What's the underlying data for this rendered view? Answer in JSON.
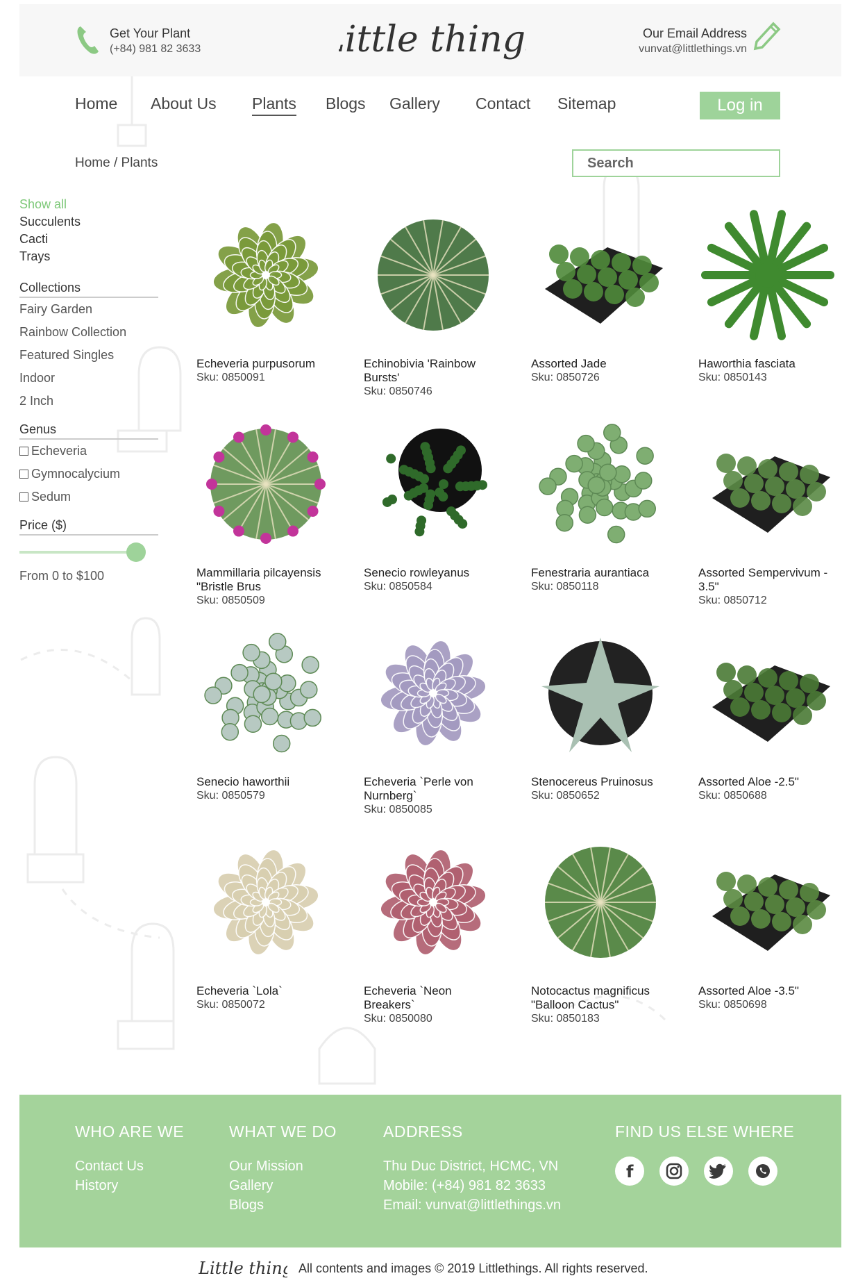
{
  "header": {
    "phone_title": "Get Your Plant",
    "phone_number": "(+84) 981 82 3633",
    "logo_text": "Little things",
    "email_title": "Our Email Address",
    "email_value": "vunvat@littlethings.vn"
  },
  "nav": {
    "items": [
      "Home",
      "About Us",
      "Plants",
      "Blogs",
      "Gallery",
      "Contact",
      "Sitemap"
    ],
    "active": "Plants",
    "login_label": "Log in"
  },
  "breadcrumb": "Home / Plants",
  "search": {
    "placeholder": "Search"
  },
  "sidebar": {
    "categories": [
      "Show all",
      "Succulents",
      "Cacti",
      "Trays"
    ],
    "collections_heading": "Collections",
    "collections": [
      "Fairy Garden",
      "Rainbow Collection",
      "Featured Singles",
      "Indoor",
      "2 Inch"
    ],
    "genus_heading": "Genus",
    "genus": [
      "Echeveria",
      "Gymnocalycium",
      "Sedum"
    ],
    "price_heading": "Price ($)",
    "price_range": "From 0 to $100"
  },
  "products": [
    {
      "name": "Echeveria purpusorum",
      "sku": "Sku: 0850091",
      "icon": "rosette",
      "color": "#7a9a3a"
    },
    {
      "name": "Echinobivia 'Rainbow Bursts'",
      "sku": "Sku: 0850746",
      "icon": "round-cactus",
      "color": "#4f7a4a"
    },
    {
      "name": "Assorted Jade",
      "sku": "Sku: 0850726",
      "icon": "tray",
      "color": "#4f8a3a"
    },
    {
      "name": "Haworthia fasciata",
      "sku": "Sku: 0850143",
      "icon": "spiky",
      "color": "#3f8a2f"
    },
    {
      "name": "Mammillaria pilcayensis \"Bristle Brus",
      "sku": "Sku: 0850509",
      "icon": "flower-cactus",
      "color": "#6f9a5f"
    },
    {
      "name": "Senecio rowleyanus",
      "sku": "Sku: 0850584",
      "icon": "pearls",
      "color": "#2f6a2a"
    },
    {
      "name": "Fenestraria aurantiaca",
      "sku": "Sku: 0850118",
      "icon": "clusters",
      "color": "#7fae72"
    },
    {
      "name": "Assorted Sempervivum - 3.5\"",
      "sku": "Sku: 0850712",
      "icon": "tray",
      "color": "#5a8a45"
    },
    {
      "name": "Senecio haworthii",
      "sku": "Sku: 0850579",
      "icon": "clusters",
      "color": "#b7c9c2"
    },
    {
      "name": "Echeveria `Perle von Nurnberg`",
      "sku": "Sku: 0850085",
      "icon": "rosette",
      "color": "#a39ac0"
    },
    {
      "name": "Stenocereus Pruinosus",
      "sku": "Sku: 0850652",
      "icon": "star-cactus",
      "color": "#a9c0b2"
    },
    {
      "name": "Assorted Aloe -2.5\"",
      "sku": "Sku: 0850688",
      "icon": "tray",
      "color": "#4a7a35"
    },
    {
      "name": "Echeveria `Lola`",
      "sku": "Sku: 0850072",
      "icon": "rosette",
      "color": "#d8cfb0"
    },
    {
      "name": "Echeveria `Neon Breakers`",
      "sku": "Sku: 0850080",
      "icon": "rosette",
      "color": "#b06070"
    },
    {
      "name": "Notocactus magnificus \"Balloon Cactus\"",
      "sku": "Sku: 0850183",
      "icon": "round-cactus",
      "color": "#5a8a4a"
    },
    {
      "name": "Assorted Aloe -3.5\"",
      "sku": "Sku: 0850698",
      "icon": "tray",
      "color": "#5a8a40"
    }
  ],
  "footer": {
    "col1": {
      "heading": "WHO ARE WE",
      "links": [
        "Contact Us",
        "History"
      ]
    },
    "col2": {
      "heading": "WHAT WE DO",
      "links": [
        "Our Mission",
        "Gallery",
        "Blogs"
      ]
    },
    "col3": {
      "heading": "ADDRESS",
      "lines": [
        "Thu Duc District, HCMC, VN",
        "Mobile: (+84) 981 82 3633",
        "Email: vunvat@littlethings.vn"
      ]
    },
    "col4": {
      "heading": "FIND US ELSE WHERE",
      "social": [
        "facebook-icon",
        "instagram-icon",
        "twitter-icon",
        "whatsapp-icon"
      ]
    },
    "copyright": "All contents and images © 2019 Littlethings. All rights reserved."
  },
  "colors": {
    "accent": "#9ed39a",
    "footer": "#a4d39b",
    "active_category": "#7dc878"
  }
}
